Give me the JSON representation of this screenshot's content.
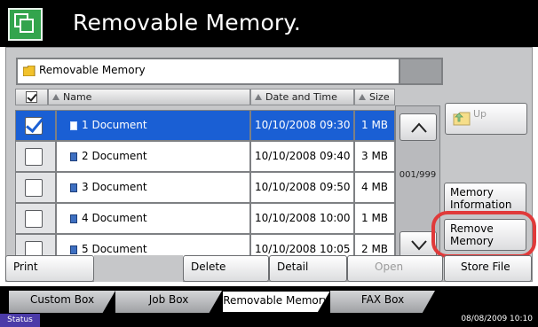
{
  "header": {
    "title": "Removable Memory.",
    "icon": "copy-documents-icon"
  },
  "path_bar": {
    "folder_icon": "folder-icon",
    "path": "Removable Memory"
  },
  "list": {
    "columns": {
      "name": "Name",
      "date": "Date and Time",
      "size": "Size"
    },
    "rows": [
      {
        "name": "1  Document",
        "date": "10/10/2008 09:30",
        "size": "1 MB",
        "checked": true
      },
      {
        "name": "2  Document",
        "date": "10/10/2008 09:40",
        "size": "3 MB",
        "checked": false
      },
      {
        "name": "3  Document",
        "date": "10/10/2008 09:50",
        "size": "4 MB",
        "checked": false
      },
      {
        "name": "4  Document",
        "date": "10/10/2008 10:00",
        "size": "1 MB",
        "checked": false
      },
      {
        "name": "5  Document",
        "date": "10/10/2008 10:05",
        "size": "2 MB",
        "checked": false
      }
    ]
  },
  "scroll": {
    "page_count": "001/999"
  },
  "side_buttons": {
    "up": "Up",
    "memory_information_line1": "Memory",
    "memory_information_line2": "Information",
    "remove_memory_line1": "Remove",
    "remove_memory_line2": "Memory"
  },
  "actions": {
    "print": "Print",
    "delete": "Delete",
    "detail": "Detail",
    "open": "Open",
    "store_file": "Store File"
  },
  "tabs": [
    "Custom Box",
    "Job Box",
    "Removable Memory",
    "FAX Box"
  ],
  "active_tab": "Removable Memory",
  "status": {
    "label": "Status",
    "datetime": "08/08/2009   10:10"
  },
  "colors": {
    "selected_row": "#1a5fd4",
    "header_bg": "#000000",
    "highlight_ring": "#e03a3a",
    "status_button": "#4b3ba8"
  }
}
